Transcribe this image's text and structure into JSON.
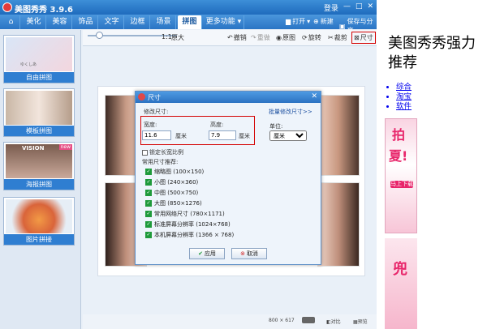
{
  "app": {
    "title": "美图秀秀 3.9.6",
    "login": "登录"
  },
  "tabs": [
    {
      "label": "美化"
    },
    {
      "label": "美容"
    },
    {
      "label": "饰品"
    },
    {
      "label": "文字"
    },
    {
      "label": "边框"
    },
    {
      "label": "场景"
    },
    {
      "label": "拼图"
    },
    {
      "label": "更多功能"
    }
  ],
  "tabbar": {
    "open": "打开",
    "new": "新建",
    "save": "保存与分享"
  },
  "toolbar": {
    "zoom_ratio": "1:1",
    "zoom_original": "原大",
    "undo": "撤销",
    "redo": "重做",
    "original": "原图",
    "rotate": "旋转",
    "crop": "裁剪",
    "resize": "尺寸"
  },
  "sidebar": [
    {
      "label": "自由拼图"
    },
    {
      "label": "模板拼图"
    },
    {
      "label": "海报拼图"
    },
    {
      "label": "图片拼接"
    }
  ],
  "sidebar_badges": {
    "poster_vision": "VISION",
    "poster_new": "new",
    "free_caption": "ゆくしあ"
  },
  "status": {
    "dimensions": "800 × 617",
    "compare": "对比",
    "preview": "预览"
  },
  "dialog": {
    "title": "尺寸",
    "section": "修改尺寸:",
    "batch": "批量修改尺寸>>",
    "width_label": "宽度:",
    "width_value": "11.6",
    "width_unit": "厘米",
    "height_label": "高度:",
    "height_value": "7.9",
    "height_unit": "厘米",
    "unit_label": "单位:",
    "unit_value": "厘米",
    "lock_ratio": "锁定长宽比例",
    "common_label": "常用尺寸推荐:",
    "ok": "应用",
    "cancel": "取消",
    "presets": [
      {
        "label": "缩略图 (100×150)"
      },
      {
        "label": "小图 (240×360)"
      },
      {
        "label": "中图 (500×750)"
      },
      {
        "label": "大图 (850×1276)"
      },
      {
        "label": "常用网络尺寸 (780×1171)"
      },
      {
        "label": "标准屏幕分辨率 (1024×768)"
      },
      {
        "label": "本机屏幕分辨率 (1366 × 768)"
      }
    ]
  },
  "web": {
    "heading": "美图秀秀强力推荐",
    "links": [
      {
        "label": "综合"
      },
      {
        "label": "淘宝"
      },
      {
        "label": "软件"
      }
    ],
    "ad_text1": "拍",
    "ad_text2": "夏!",
    "ad_button": "马上下载",
    "ad_text3": "兜"
  }
}
